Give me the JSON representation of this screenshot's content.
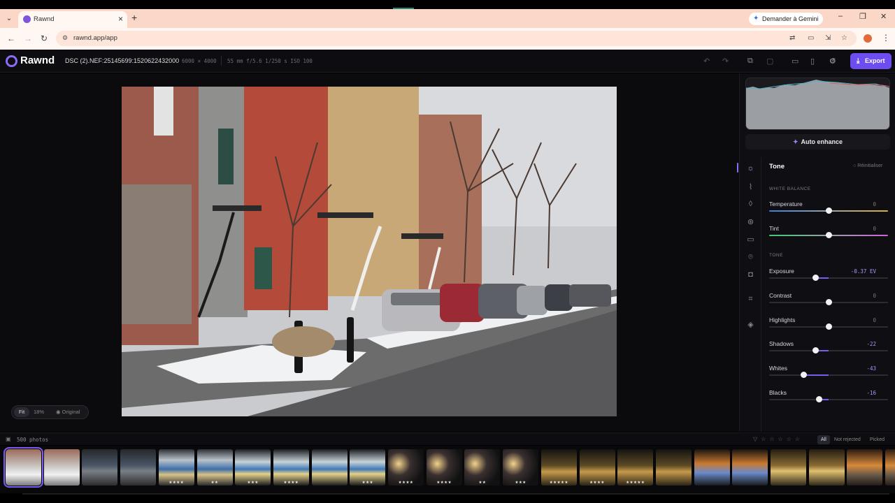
{
  "browser": {
    "tab_title": "Rawnd",
    "url": "rawnd.app/app",
    "gemini_label": "Demander à Gemini"
  },
  "app": {
    "name": "Rawnd",
    "filename": "DSC (2).NEF:25145699:1520622432000",
    "dimensions": "6000 × 4000",
    "exif": "55 mm  f/5.6  1/250 s  ISO 100",
    "export_label": "Export",
    "accent": "#6d4cf0"
  },
  "canvas": {
    "zoom_fit": "Fit",
    "zoom_percent": "18%",
    "original_label": "Original"
  },
  "panel": {
    "auto_enhance": "Auto enhance",
    "section_title": "Tone",
    "reset_label": "Réinitialiser",
    "groups": {
      "white_balance": "WHITE BALANCE",
      "tone": "TONE"
    },
    "controls": [
      {
        "label": "Temperature",
        "value": "0",
        "level": 0.5,
        "gradient": "temp"
      },
      {
        "label": "Tint",
        "value": "0",
        "level": 0.5,
        "gradient": "tint"
      },
      {
        "label": "Exposure",
        "value": "-0.37 EV",
        "level": 0.39
      },
      {
        "label": "Contrast",
        "value": "0",
        "level": 0.5
      },
      {
        "label": "Highlights",
        "value": "0",
        "level": 0.5
      },
      {
        "label": "Shadows",
        "value": "-22",
        "level": 0.39
      },
      {
        "label": "Whites",
        "value": "-43",
        "level": 0.29
      },
      {
        "label": "Blacks",
        "value": "-16",
        "level": 0.42
      }
    ]
  },
  "filmstrip": {
    "count_label": "500 photos",
    "filters": [
      "All",
      "Not rejected",
      "Picked"
    ],
    "thumbs": [
      {
        "kind": "street",
        "stars": ""
      },
      {
        "kind": "street",
        "stars": ""
      },
      {
        "kind": "metro",
        "stars": ""
      },
      {
        "kind": "metro",
        "stars": ""
      },
      {
        "kind": "train",
        "stars": "★★★★"
      },
      {
        "kind": "train",
        "stars": "★★"
      },
      {
        "kind": "blur",
        "stars": "★★★"
      },
      {
        "kind": "blur",
        "stars": "★★★★"
      },
      {
        "kind": "blur",
        "stars": ""
      },
      {
        "kind": "blur",
        "stars": "★★★"
      },
      {
        "kind": "night",
        "stars": "★★★★"
      },
      {
        "kind": "night",
        "stars": "★★★★"
      },
      {
        "kind": "night",
        "stars": "★★"
      },
      {
        "kind": "night",
        "stars": "★★★"
      },
      {
        "kind": "dusk",
        "stars": "★★★★★"
      },
      {
        "kind": "dusk",
        "stars": "★★★★"
      },
      {
        "kind": "dusk",
        "stars": "★★★★★"
      },
      {
        "kind": "dusk",
        "stars": ""
      },
      {
        "kind": "city",
        "stars": ""
      },
      {
        "kind": "city",
        "stars": ""
      },
      {
        "kind": "road",
        "stars": ""
      },
      {
        "kind": "road",
        "stars": ""
      },
      {
        "kind": "lights",
        "stars": ""
      },
      {
        "kind": "lights",
        "stars": ""
      }
    ]
  }
}
